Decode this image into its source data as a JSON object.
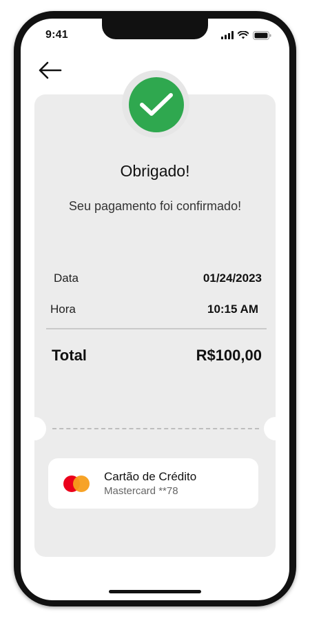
{
  "status_bar": {
    "time": "9:41",
    "icons": [
      "signal-icon",
      "wifi-icon",
      "battery-icon"
    ]
  },
  "nav": {
    "back_icon": "arrow-left-icon"
  },
  "confirmation": {
    "icon": "checkmark-icon",
    "icon_color": "#2fa84f",
    "title": "Obrigado!",
    "message": "Seu pagamento foi confirmado!"
  },
  "details": {
    "date_label": "Data",
    "date_value": "01/24/2023",
    "time_label": "Hora",
    "time_value": "10:15 AM",
    "total_label": "Total",
    "total_value": "R$100,00"
  },
  "payment_method": {
    "brand_icon": "mastercard-icon",
    "title": "Cartão de Crédito",
    "subtitle": "Mastercard **78"
  },
  "colors": {
    "card_background": "#ececec",
    "success": "#2fa84f",
    "mastercard_red": "#eb001b",
    "mastercard_orange": "#f79e1b"
  }
}
